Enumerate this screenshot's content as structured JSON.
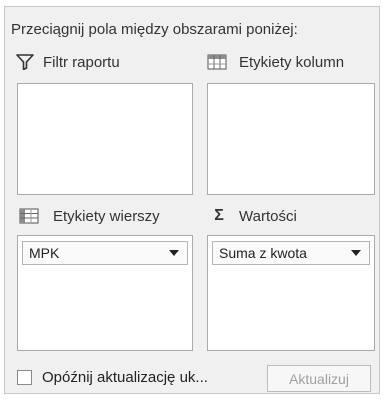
{
  "instruction": "Przeciągnij pola między obszarami poniżej:",
  "areas": {
    "filter": {
      "label": "Filtr raportu",
      "icon": "filter-funnel-icon",
      "fields": []
    },
    "columns": {
      "label": "Etykiety kolumn",
      "icon": "column-grid-icon",
      "fields": []
    },
    "rows": {
      "label": "Etykiety wierszy",
      "icon": "row-grid-icon",
      "fields": [
        "MPK"
      ]
    },
    "values": {
      "label": "Wartości",
      "icon": "sigma-icon",
      "icon_glyph": "Σ",
      "fields": [
        "Suma z kwota"
      ]
    }
  },
  "defer_update": {
    "label": "Opóźnij aktualizację uk...",
    "checked": false
  },
  "update_button": {
    "label": "Aktualizuj",
    "enabled": false
  }
}
